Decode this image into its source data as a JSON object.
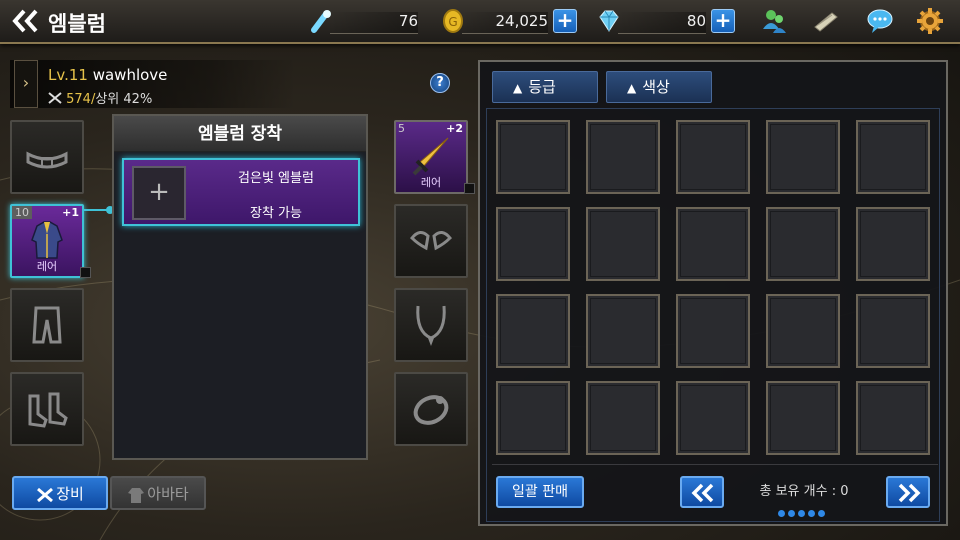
{
  "header": {
    "title": "엠블럼",
    "stamina": "76",
    "gold": "24,025",
    "gems": "80",
    "colors": {
      "accent_blue": "#1f6fd0",
      "gold_text": "#e6c24a",
      "rare_purple": "#5a2a8a",
      "highlight_cyan": "#3fc2d6"
    }
  },
  "profile": {
    "level_prefix": "Lv.11",
    "name": "wawhlove",
    "power_value": "574/",
    "rank": "상위 42%"
  },
  "equip": {
    "left_slots": [
      {
        "icon": "belt-icon"
      },
      {
        "icon": "armor-coat-icon",
        "level": "10",
        "plus": "+1",
        "grade": "레어"
      },
      {
        "icon": "pants-icon"
      },
      {
        "icon": "boots-icon"
      }
    ],
    "right_slots": [
      {
        "icon": "sword-icon",
        "level": "5",
        "plus": "+2",
        "grade": "레어"
      },
      {
        "icon": "shoulder-icon"
      },
      {
        "icon": "necklace-icon"
      },
      {
        "icon": "ring-icon"
      }
    ]
  },
  "emblem": {
    "panel_title": "엠블럼 장착",
    "slot_name": "검은빛 엠블럼",
    "slot_status": "장착 가능",
    "plus_symbol": "+"
  },
  "tabs": {
    "equip": "장비",
    "avatar": "아바타"
  },
  "inventory": {
    "sort_grade": "등급",
    "sort_color": "색상",
    "sort_arrow": "▲",
    "sell_all": "일괄 판매",
    "total_label": "총 보유 개수 : 0",
    "page_dots": 5
  },
  "help_symbol": "?"
}
